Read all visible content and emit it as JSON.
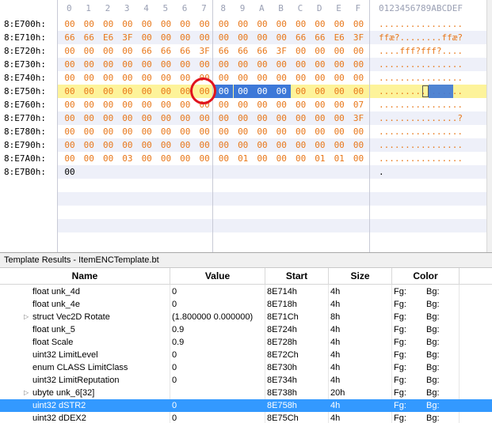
{
  "hex": {
    "col_labels": [
      "0",
      "1",
      "2",
      "3",
      "4",
      "5",
      "6",
      "7",
      "8",
      "9",
      "A",
      "B",
      "C",
      "D",
      "E",
      "F"
    ],
    "ascii_header": "0123456789ABCDEF",
    "rows": [
      {
        "addr": "8:E700h:",
        "bytes": [
          "00",
          "00",
          "00",
          "00",
          "00",
          "00",
          "00",
          "00",
          "00",
          "00",
          "00",
          "00",
          "00",
          "00",
          "00",
          "00"
        ],
        "ascii": "................"
      },
      {
        "addr": "8:E710h:",
        "bytes": [
          "66",
          "66",
          "E6",
          "3F",
          "00",
          "00",
          "00",
          "00",
          "00",
          "00",
          "00",
          "00",
          "66",
          "66",
          "E6",
          "3F"
        ],
        "ascii": "ffæ?........ffæ?"
      },
      {
        "addr": "8:E720h:",
        "bytes": [
          "00",
          "00",
          "00",
          "00",
          "66",
          "66",
          "66",
          "3F",
          "66",
          "66",
          "66",
          "3F",
          "00",
          "00",
          "00",
          "00"
        ],
        "ascii": "....fff?fff?...."
      },
      {
        "addr": "8:E730h:",
        "bytes": [
          "00",
          "00",
          "00",
          "00",
          "00",
          "00",
          "00",
          "00",
          "00",
          "00",
          "00",
          "00",
          "00",
          "00",
          "00",
          "00"
        ],
        "ascii": "................"
      },
      {
        "addr": "8:E740h:",
        "bytes": [
          "00",
          "00",
          "00",
          "00",
          "00",
          "00",
          "00",
          "00",
          "00",
          "00",
          "00",
          "00",
          "00",
          "00",
          "00",
          "00"
        ],
        "ascii": "................"
      },
      {
        "addr": "8:E750h:",
        "bytes": [
          "00",
          "00",
          "00",
          "00",
          "00",
          "00",
          "00",
          "00",
          "00",
          "00",
          "00",
          "00",
          "00",
          "00",
          "00",
          "00"
        ],
        "ascii": "................"
      },
      {
        "addr": "8:E760h:",
        "bytes": [
          "00",
          "00",
          "00",
          "00",
          "00",
          "00",
          "00",
          "00",
          "00",
          "00",
          "00",
          "00",
          "00",
          "00",
          "00",
          "07"
        ],
        "ascii": "................"
      },
      {
        "addr": "8:E770h:",
        "bytes": [
          "00",
          "00",
          "00",
          "00",
          "00",
          "00",
          "00",
          "00",
          "00",
          "00",
          "00",
          "00",
          "00",
          "00",
          "00",
          "3F"
        ],
        "ascii": "...............?"
      },
      {
        "addr": "8:E780h:",
        "bytes": [
          "00",
          "00",
          "00",
          "00",
          "00",
          "00",
          "00",
          "00",
          "00",
          "00",
          "00",
          "00",
          "00",
          "00",
          "00",
          "00"
        ],
        "ascii": "................"
      },
      {
        "addr": "8:E790h:",
        "bytes": [
          "00",
          "00",
          "00",
          "00",
          "00",
          "00",
          "00",
          "00",
          "00",
          "00",
          "00",
          "00",
          "00",
          "00",
          "00",
          "00"
        ],
        "ascii": "................"
      },
      {
        "addr": "8:E7A0h:",
        "bytes": [
          "00",
          "00",
          "00",
          "03",
          "00",
          "00",
          "00",
          "00",
          "00",
          "01",
          "00",
          "00",
          "00",
          "01",
          "01",
          "00"
        ],
        "ascii": "................"
      },
      {
        "addr": "8:E7B0h:",
        "bytes": [
          "00"
        ],
        "ascii": "."
      }
    ],
    "highlight_row": 5,
    "selected_bytes": [
      8,
      11
    ],
    "circled_byte": 7,
    "colors": {
      "byte_text": "#e87719",
      "highlight": "#fdf39a",
      "selection": "#3d78d8",
      "circle": "#e0141e"
    }
  },
  "template_results": {
    "title": "Template Results - ItemENCTemplate.bt",
    "columns": {
      "name": "Name",
      "value": "Value",
      "start": "Start",
      "size": "Size",
      "color": "Color"
    },
    "selected_row": 10,
    "rows": [
      {
        "name": "float unk_4d",
        "value": "0",
        "start": "8E714h",
        "size": "4h",
        "fg": "Fg:",
        "bg": "Bg:",
        "expandable": false
      },
      {
        "name": "float unk_4e",
        "value": "0",
        "start": "8E718h",
        "size": "4h",
        "fg": "Fg:",
        "bg": "Bg:",
        "expandable": false
      },
      {
        "name": "struct Vec2D Rotate",
        "value": "(1.800000 0.000000)",
        "start": "8E71Ch",
        "size": "8h",
        "fg": "Fg:",
        "bg": "Bg:",
        "expandable": true
      },
      {
        "name": "float unk_5",
        "value": "0.9",
        "start": "8E724h",
        "size": "4h",
        "fg": "Fg:",
        "bg": "Bg:",
        "expandable": false
      },
      {
        "name": "float Scale",
        "value": "0.9",
        "start": "8E728h",
        "size": "4h",
        "fg": "Fg:",
        "bg": "Bg:",
        "expandable": false
      },
      {
        "name": "uint32 LimitLevel",
        "value": "0",
        "start": "8E72Ch",
        "size": "4h",
        "fg": "Fg:",
        "bg": "Bg:",
        "expandable": false
      },
      {
        "name": "enum CLASS LimitClass",
        "value": "0",
        "start": "8E730h",
        "size": "4h",
        "fg": "Fg:",
        "bg": "Bg:",
        "expandable": false
      },
      {
        "name": "uint32 LimitReputation",
        "value": "0",
        "start": "8E734h",
        "size": "4h",
        "fg": "Fg:",
        "bg": "Bg:",
        "expandable": false
      },
      {
        "name": "ubyte unk_6[32]",
        "value": "",
        "start": "8E738h",
        "size": "20h",
        "fg": "Fg:",
        "bg": "Bg:",
        "expandable": true
      },
      {
        "name": "uint32 dSTR2",
        "value": "0",
        "start": "8E758h",
        "size": "4h",
        "fg": "Fg:",
        "bg": "Bg:",
        "expandable": false
      },
      {
        "name": "uint32 dDEX2",
        "value": "0",
        "start": "8E75Ch",
        "size": "4h",
        "fg": "Fg:",
        "bg": "Bg:",
        "expandable": false
      }
    ]
  }
}
